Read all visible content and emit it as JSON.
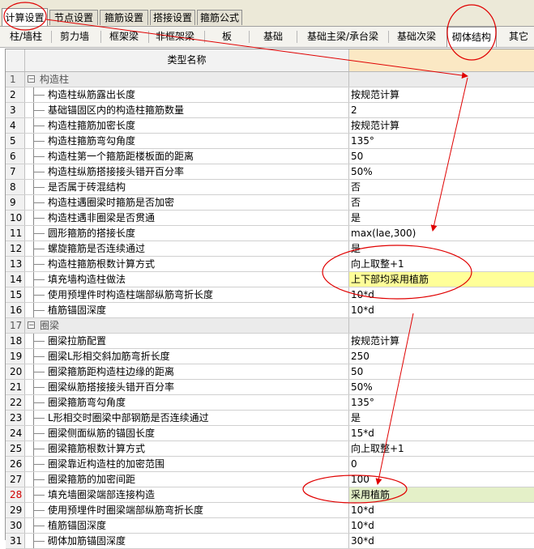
{
  "top_tabs": [
    "计算设置",
    "节点设置",
    "箍筋设置",
    "搭接设置",
    "箍筋公式"
  ],
  "sub_tabs": [
    "柱/墙柱",
    "剪力墙",
    "框架梁",
    "非框架梁",
    "板",
    "基础",
    "基础主梁/承台梁",
    "基础次梁",
    "砌体结构",
    "其它"
  ],
  "grid": {
    "header_name": "类型名称"
  },
  "rows": [
    {
      "n": "1",
      "name": "构造柱",
      "value": "",
      "group": true
    },
    {
      "n": "2",
      "name": "构造柱纵筋露出长度",
      "value": "按规范计算"
    },
    {
      "n": "3",
      "name": "基础锚固区内的构造柱箍筋数量",
      "value": "2"
    },
    {
      "n": "4",
      "name": "构造柱箍筋加密长度",
      "value": "按规范计算"
    },
    {
      "n": "5",
      "name": "构造柱箍筋弯勾角度",
      "value": "135°"
    },
    {
      "n": "6",
      "name": "构造柱第一个箍筋距楼板面的距离",
      "value": "50"
    },
    {
      "n": "7",
      "name": "构造柱纵筋搭接接头错开百分率",
      "value": "50%"
    },
    {
      "n": "8",
      "name": "是否属于砖混结构",
      "value": "否"
    },
    {
      "n": "9",
      "name": "构造柱遇圈梁时箍筋是否加密",
      "value": "否"
    },
    {
      "n": "10",
      "name": "构造柱遇非圈梁是否贯通",
      "value": "是"
    },
    {
      "n": "11",
      "name": "圆形箍筋的搭接长度",
      "value": "max(lae,300)"
    },
    {
      "n": "12",
      "name": "螺旋箍筋是否连续通过",
      "value": "是"
    },
    {
      "n": "13",
      "name": "构造柱箍筋根数计算方式",
      "value": "向上取整+1"
    },
    {
      "n": "14",
      "name": "填充墙构造柱做法",
      "value": "上下部均采用植筋"
    },
    {
      "n": "15",
      "name": "使用预埋件时构造柱端部纵筋弯折长度",
      "value": "10*d"
    },
    {
      "n": "16",
      "name": "植筋锚固深度",
      "value": "10*d"
    },
    {
      "n": "17",
      "name": "圈梁",
      "value": "",
      "group": true
    },
    {
      "n": "18",
      "name": "圈梁拉筋配置",
      "value": "按规范计算"
    },
    {
      "n": "19",
      "name": "圈梁L形相交斜加筋弯折长度",
      "value": "250"
    },
    {
      "n": "20",
      "name": "圈梁箍筋距构造柱边缘的距离",
      "value": "50"
    },
    {
      "n": "21",
      "name": "圈梁纵筋搭接接头错开百分率",
      "value": "50%"
    },
    {
      "n": "22",
      "name": "圈梁箍筋弯勾角度",
      "value": "135°"
    },
    {
      "n": "23",
      "name": "L形相交时圈梁中部钢筋是否连续通过",
      "value": "是"
    },
    {
      "n": "24",
      "name": "圈梁侧面纵筋的锚固长度",
      "value": "15*d"
    },
    {
      "n": "25",
      "name": "圈梁箍筋根数计算方式",
      "value": "向上取整+1"
    },
    {
      "n": "26",
      "name": "圈梁靠近构造柱的加密范围",
      "value": "0"
    },
    {
      "n": "27",
      "name": "圈梁箍筋的加密间距",
      "value": "100"
    },
    {
      "n": "28",
      "name": "填充墙圈梁端部连接构造",
      "value": "采用植筋"
    },
    {
      "n": "29",
      "name": "使用预埋件时圈梁端部纵筋弯折长度",
      "value": "10*d"
    },
    {
      "n": "30",
      "name": "植筋锚固深度",
      "value": "10*d"
    },
    {
      "n": "31",
      "name": "砌体加筋锚固深度",
      "value": "30*d"
    }
  ]
}
